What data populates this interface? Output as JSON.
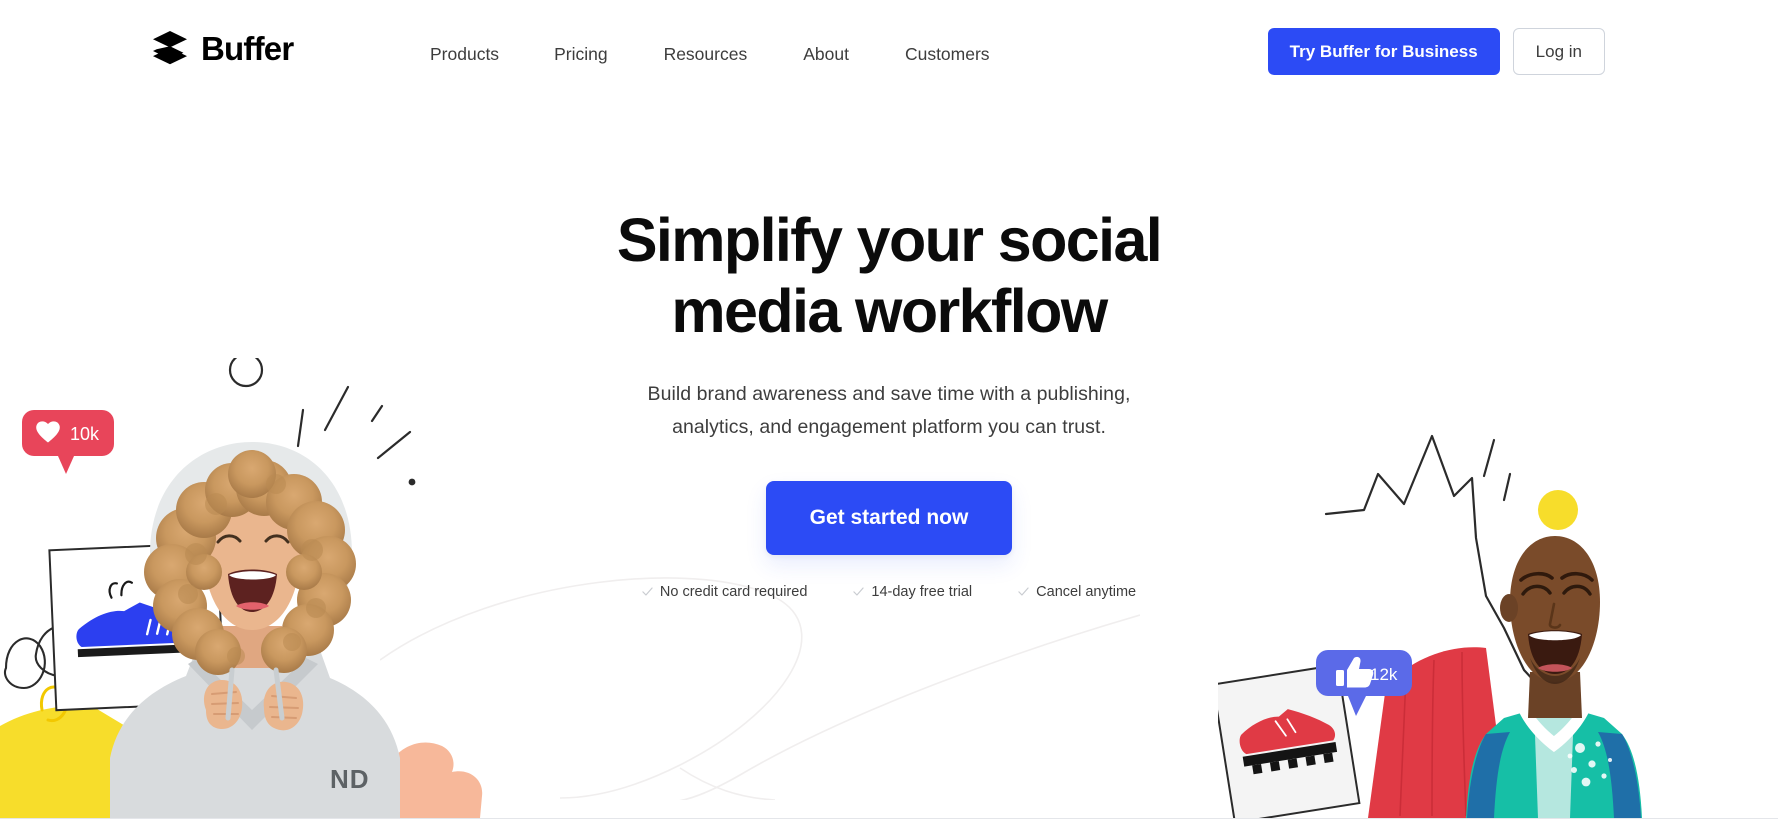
{
  "brand": {
    "name": "Buffer",
    "logo_icon": "buffer-layers-icon"
  },
  "nav": {
    "items": [
      {
        "label": "Products"
      },
      {
        "label": "Pricing"
      },
      {
        "label": "Resources"
      },
      {
        "label": "About"
      },
      {
        "label": "Customers"
      }
    ]
  },
  "header_actions": {
    "primary_label": "Try Buffer for Business",
    "login_label": "Log in"
  },
  "hero": {
    "title_line_1": "Simplify your social",
    "title_line_2": "media workflow",
    "subtitle_line_1": "Build brand awareness and save time with a publishing,",
    "subtitle_line_2": "analytics, and engagement platform you can trust.",
    "cta_label": "Get started now",
    "trust": [
      {
        "label": "No credit card required",
        "icon": "check-icon"
      },
      {
        "label": "14-day free trial",
        "icon": "check-icon"
      },
      {
        "label": "Cancel anytime",
        "icon": "check-icon"
      }
    ]
  },
  "illustration_left": {
    "description": "Smiling woman with curly blonde hair in a gray hoodie",
    "like_badge_value": "10k",
    "like_badge_icon": "heart-icon",
    "post_card_icon": "blue-sneaker-icon",
    "shapes": [
      "yellow-blob",
      "peach-blob",
      "circle-outline",
      "scribble-loops",
      "accent-lines"
    ]
  },
  "illustration_right": {
    "description": "Smiling man in a teal and white sports jersey",
    "like_badge_value": "12k",
    "like_badge_icon": "thumbs-up-icon",
    "post_card_icon": "red-cleat-icon",
    "shapes": [
      "red-blob",
      "yellow-dot",
      "zigzag-outline",
      "accent-lines"
    ]
  },
  "colors": {
    "brand_blue": "#2c4bf5",
    "heart_badge_red": "#e8455a",
    "thumb_badge_blue": "#5b6ae8",
    "accent_yellow": "#f7dd2b",
    "accent_peach": "#f7b89a",
    "accent_red": "#e03a45",
    "text_dark": "#0b0b0b",
    "text_body": "#3d3d3d",
    "shoe_blue": "#2c3ff0",
    "jersey_teal": "#16bfa6",
    "page_background": "#ffffff"
  }
}
